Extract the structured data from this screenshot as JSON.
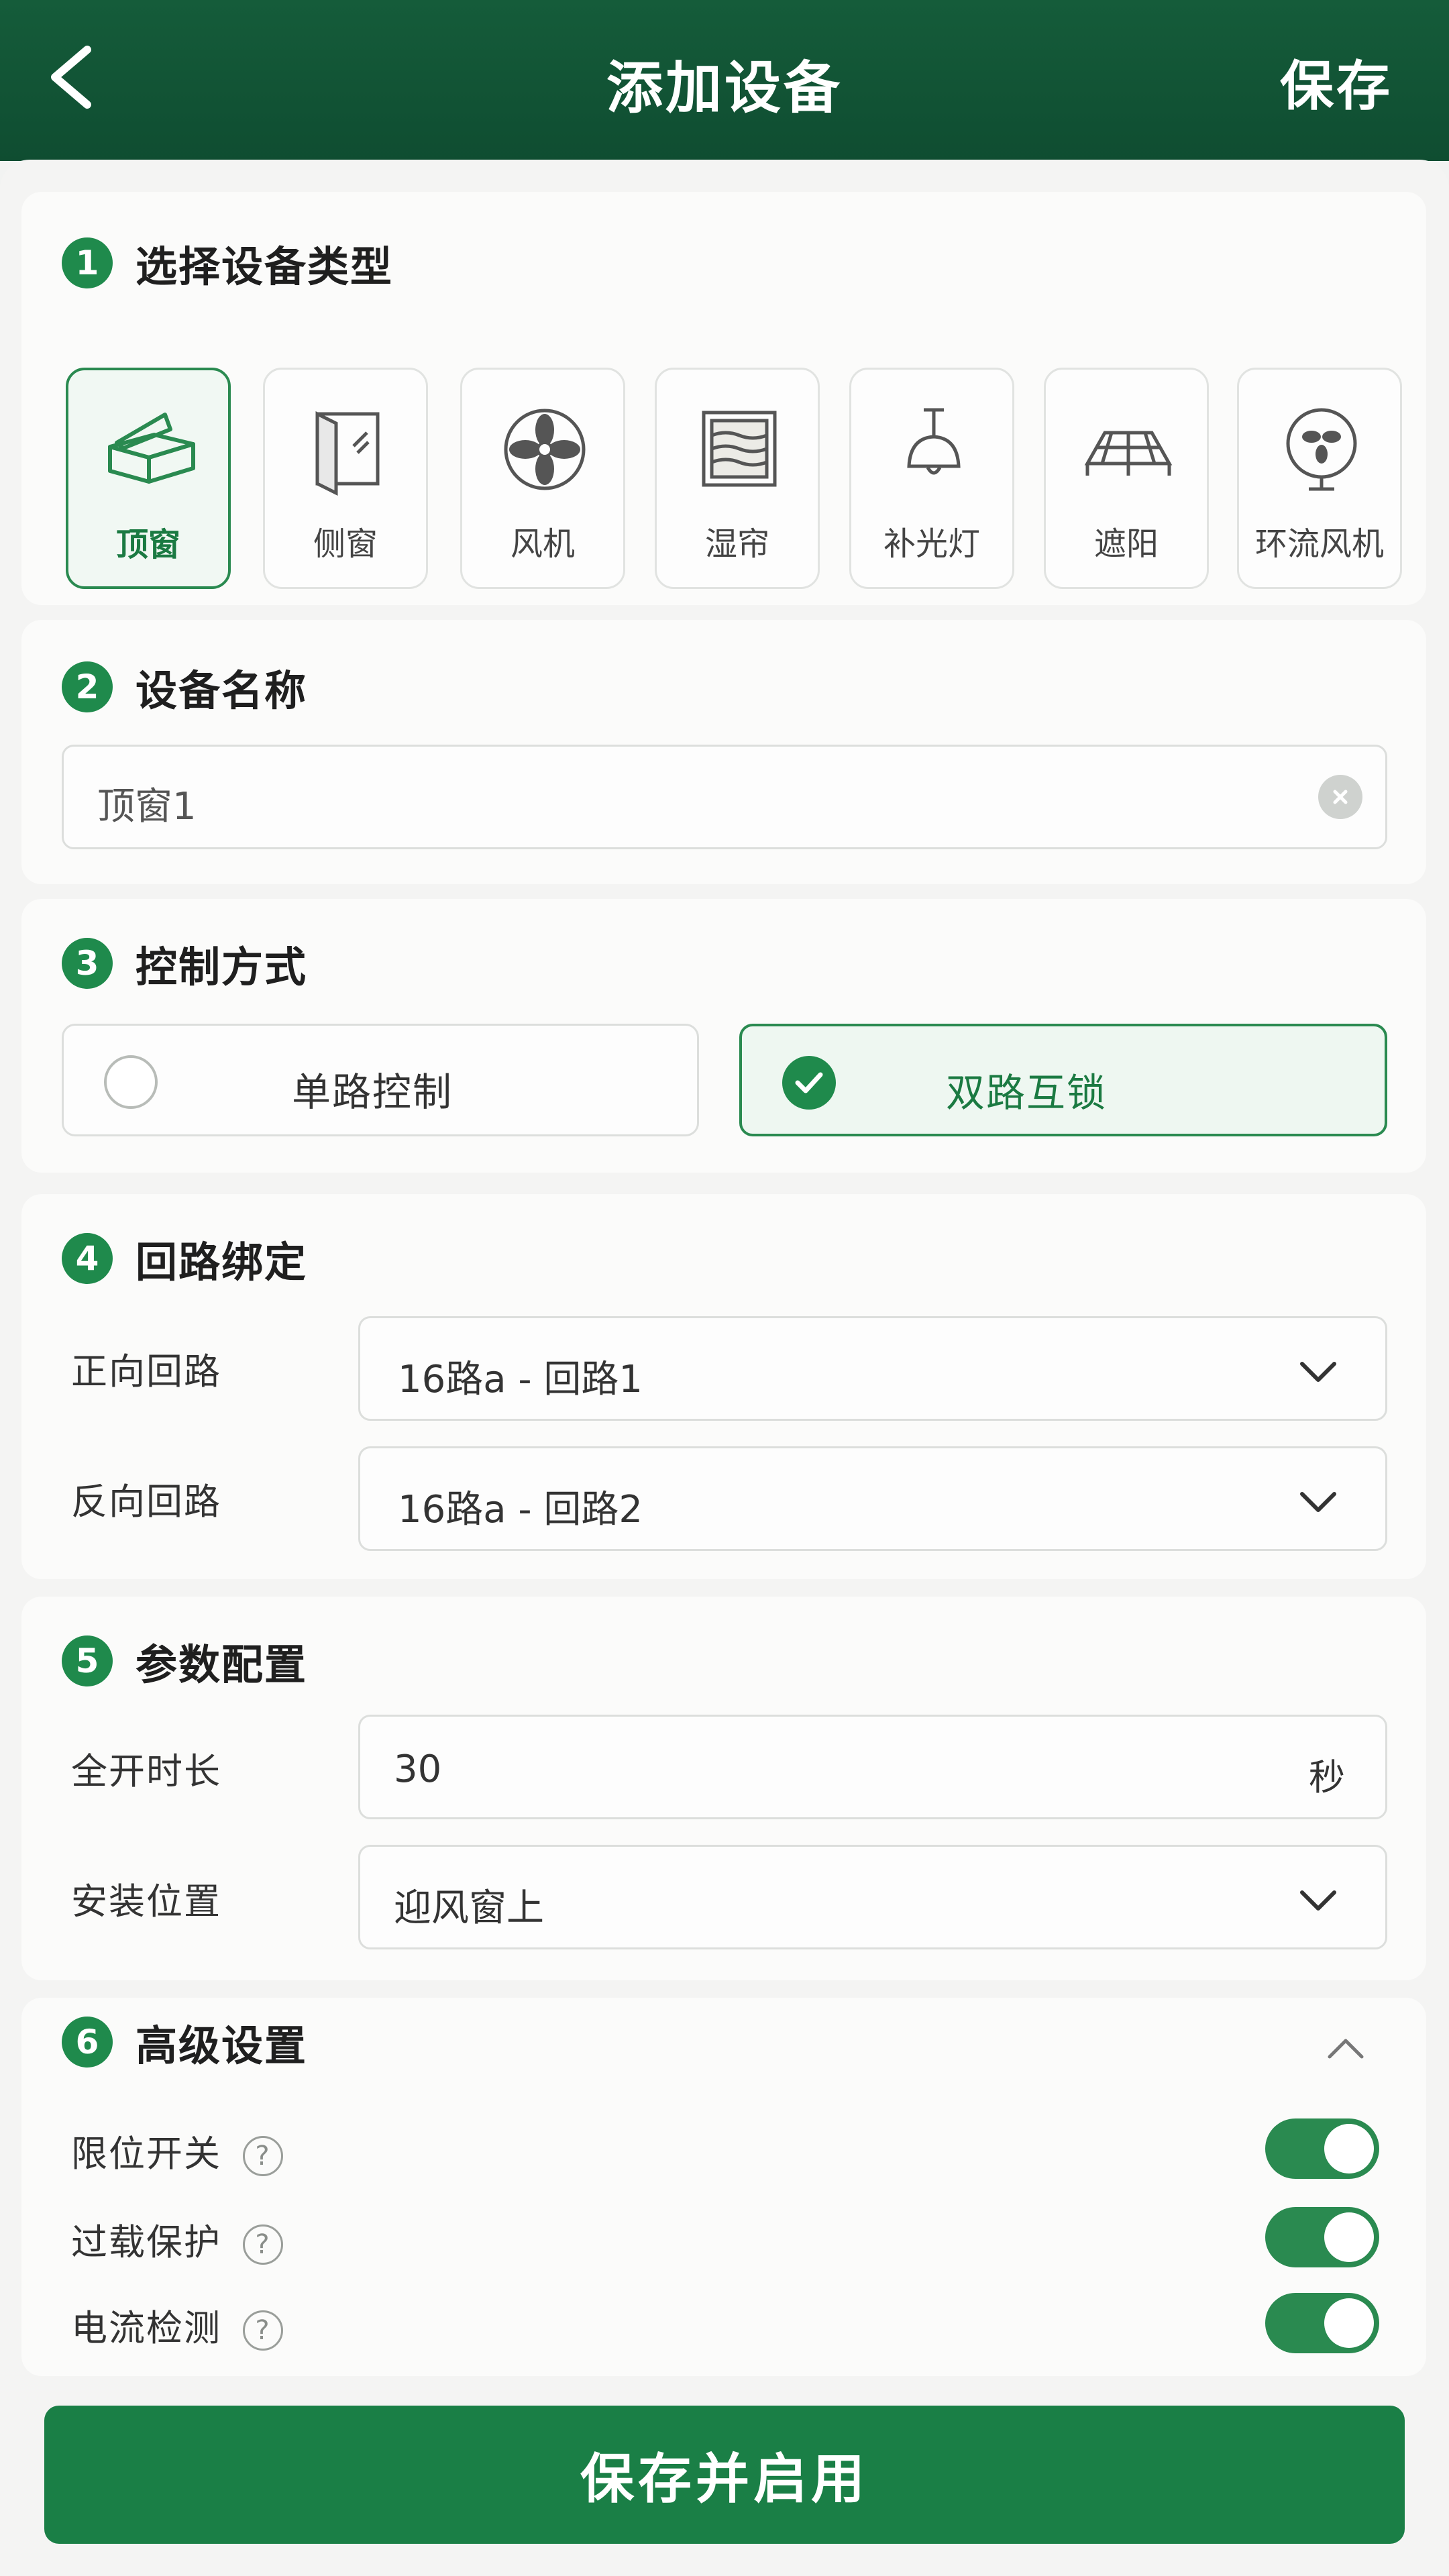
{
  "header": {
    "title": "添加设备",
    "save_label": "保存"
  },
  "section1": {
    "number": "1",
    "title": "选择设备类型",
    "devices": [
      {
        "label": "顶窗",
        "icon": "roof-window-icon"
      },
      {
        "label": "侧窗",
        "icon": "side-window-icon"
      },
      {
        "label": "风机",
        "icon": "fan-icon"
      },
      {
        "label": "湿帘",
        "icon": "wet-curtain-icon"
      },
      {
        "label": "补光灯",
        "icon": "grow-light-icon"
      },
      {
        "label": "遮阳",
        "icon": "shade-icon"
      },
      {
        "label": "环流风机",
        "icon": "circulation-fan-icon"
      }
    ],
    "selected": "顶窗"
  },
  "section2": {
    "number": "2",
    "title": "设备名称",
    "value": "顶窗1"
  },
  "section3": {
    "number": "3",
    "title": "控制方式",
    "options": [
      {
        "label": "单路控制",
        "checked": false
      },
      {
        "label": "双路互锁",
        "checked": true
      }
    ]
  },
  "section4": {
    "number": "4",
    "title": "回路绑定",
    "forward_label": "正向回路",
    "forward_value": "16路a - 回路1",
    "reverse_label": "反向回路",
    "reverse_value": "16路a - 回路2"
  },
  "section5": {
    "number": "5",
    "title": "参数配置",
    "duration_label": "全开时长",
    "duration_value": "30",
    "duration_unit": "秒",
    "position_label": "安装位置",
    "position_value": "迎风窗上"
  },
  "section6": {
    "number": "6",
    "title": "高级设置",
    "toggles": [
      {
        "label": "限位开关",
        "help": "?",
        "on": true
      },
      {
        "label": "过载保护",
        "help": "?",
        "on": true
      },
      {
        "label": "电流检测",
        "help": "?",
        "on": true
      }
    ]
  },
  "footer": {
    "primary_label": "保存并启用"
  },
  "colors": {
    "brand": "#155c3a",
    "accent": "#1f8a4c",
    "button": "#1a7f46"
  }
}
